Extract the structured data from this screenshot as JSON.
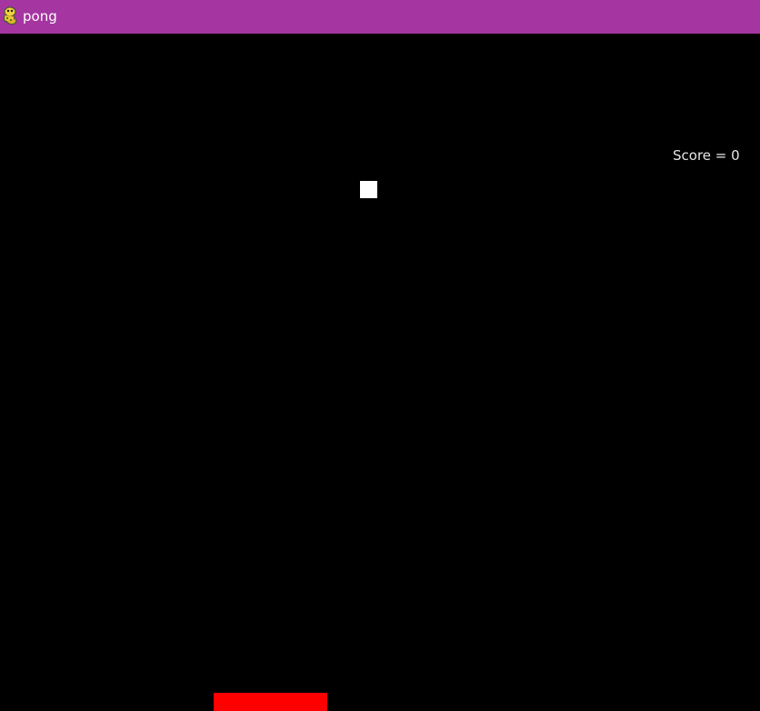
{
  "window": {
    "title": "pong",
    "icon": "pygame-snake-icon",
    "titlebar_color": "#a535a0"
  },
  "game": {
    "background_color": "#000000",
    "score_label": "Score = 0",
    "score": 0,
    "ball_color": "#ffffff",
    "paddle_color": "#ff0000"
  }
}
